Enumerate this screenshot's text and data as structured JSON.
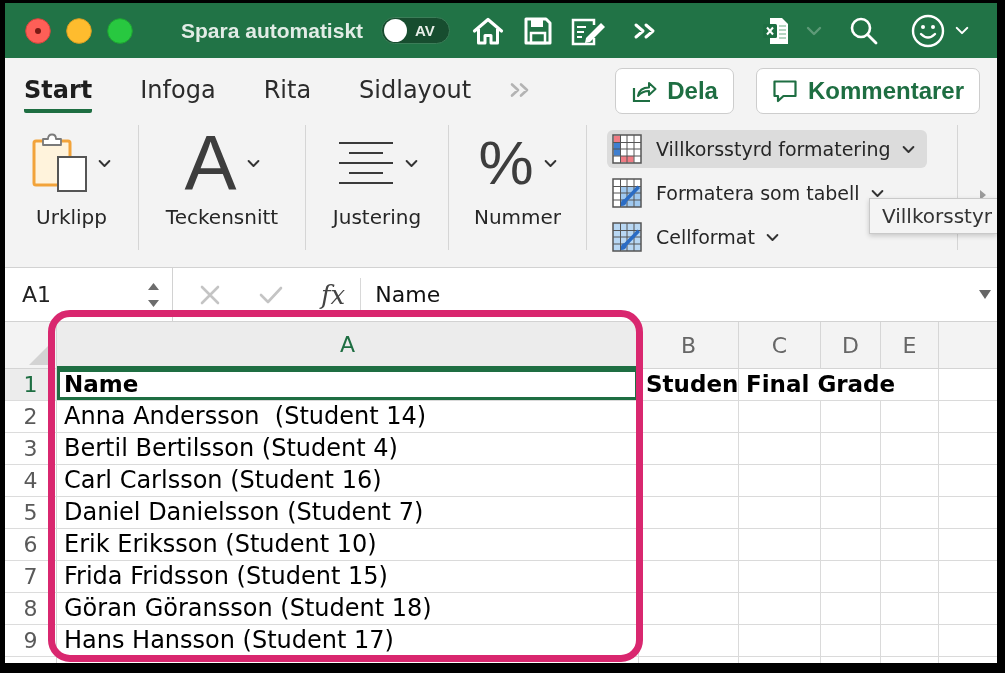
{
  "title_bar": {
    "autosave": {
      "label": "Spara automatiskt",
      "on": false,
      "toggle_text": "AV"
    }
  },
  "ribbon": {
    "tabs": [
      {
        "label": "Start",
        "selected": true
      },
      {
        "label": "Infoga",
        "selected": false
      },
      {
        "label": "Rita",
        "selected": false
      },
      {
        "label": "Sidlayout",
        "selected": false
      }
    ],
    "share_button": "Dela",
    "comments_button": "Kommentarer",
    "groups": [
      {
        "kind": "clipboard",
        "label": "Urklipp"
      },
      {
        "kind": "font",
        "label": "Teckensnitt",
        "glyph": "A"
      },
      {
        "kind": "alignment",
        "label": "Justering"
      },
      {
        "kind": "number",
        "label": "Nummer",
        "glyph": "%"
      }
    ],
    "styles": [
      {
        "kind": "conditional",
        "label": "Villkorsstyrd formatering",
        "hovered": true
      },
      {
        "kind": "table",
        "label": "Formatera som tabell",
        "hovered": false
      },
      {
        "kind": "cell",
        "label": "Cellformat",
        "hovered": false
      }
    ],
    "tooltip": "Villkorsstyr"
  },
  "formula_bar": {
    "name_box": "A1",
    "function_button": "fx",
    "formula": "Name"
  },
  "sheet": {
    "columns": [
      {
        "label": "A",
        "selected": true
      },
      {
        "label": "B",
        "selected": false
      },
      {
        "label": "C",
        "selected": false
      },
      {
        "label": "D",
        "selected": false
      },
      {
        "label": "E",
        "selected": false
      }
    ],
    "rows": [
      {
        "number": "1",
        "selected": true,
        "bold": true,
        "cells": [
          "Name",
          "Studen",
          "Final Grade"
        ]
      },
      {
        "number": "2",
        "selected": false,
        "bold": false,
        "cells": [
          "Anna Andersson  (Student 14)"
        ]
      },
      {
        "number": "3",
        "selected": false,
        "bold": false,
        "cells": [
          "Bertil Bertilsson (Student 4)"
        ]
      },
      {
        "number": "4",
        "selected": false,
        "bold": false,
        "cells": [
          "Carl Carlsson (Student 16)"
        ]
      },
      {
        "number": "5",
        "selected": false,
        "bold": false,
        "cells": [
          "Daniel Danielsson (Student 7)"
        ]
      },
      {
        "number": "6",
        "selected": false,
        "bold": false,
        "cells": [
          "Erik Eriksson (Student 10)"
        ]
      },
      {
        "number": "7",
        "selected": false,
        "bold": false,
        "cells": [
          "Frida Fridsson (Student 15)"
        ]
      },
      {
        "number": "8",
        "selected": false,
        "bold": false,
        "cells": [
          "Göran Göransson (Student 18)"
        ]
      },
      {
        "number": "9",
        "selected": false,
        "bold": false,
        "cells": [
          "Hans Hansson (Student 17)"
        ]
      }
    ]
  }
}
